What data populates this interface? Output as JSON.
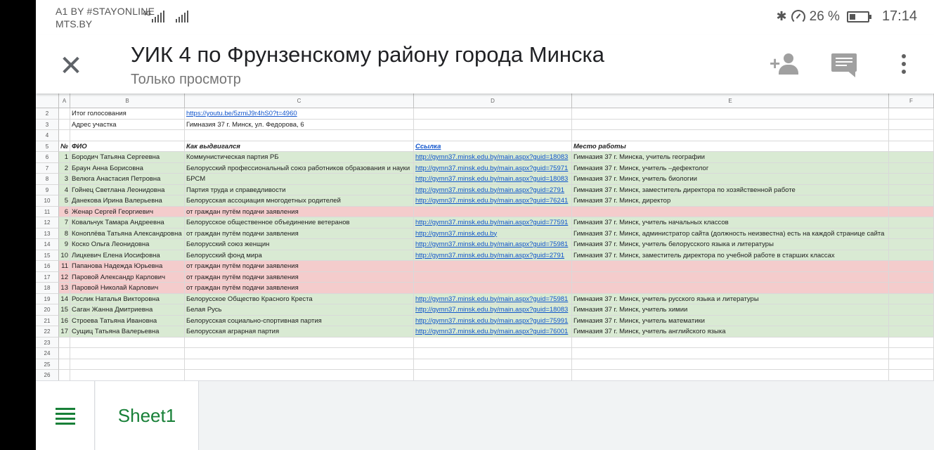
{
  "status_bar": {
    "carrier_line1": "A1 BY #STAYONLINE",
    "carrier_line2": "MTS.BY",
    "network": "4G",
    "bluetooth_icon": "bluetooth-icon",
    "battery_percent": "26 %",
    "time": "17:14"
  },
  "app_bar": {
    "title": "УИК 4 по Фрунзенскому району города Минска",
    "subtitle": "Только просмотр",
    "close_icon": "close-icon",
    "add_person_icon": "add-person-icon",
    "comment_icon": "comment-icon",
    "more_icon": "more-vert-icon"
  },
  "columns": [
    "A",
    "B",
    "C",
    "D",
    "E",
    "F"
  ],
  "rows": [
    {
      "n": "2",
      "a": "",
      "b": "Итог голосования",
      "c": "https://youtu.be/5zmiJ9r4hS0?t=4960",
      "d": "",
      "e": "",
      "c_link": true,
      "style": ""
    },
    {
      "n": "3",
      "a": "",
      "b": "Адрес участка",
      "c": "Гимназия 37 г. Минск, ул. Федорова, 6",
      "d": "",
      "e": "",
      "style": ""
    },
    {
      "n": "4",
      "a": "",
      "b": "",
      "c": "",
      "d": "",
      "e": "",
      "style": ""
    },
    {
      "n": "5",
      "a": "№",
      "b": "ФИО",
      "c": "Как выдвигался",
      "d": "Ссылка",
      "e": "Место работы",
      "style": "header"
    },
    {
      "n": "6",
      "a": "1",
      "b": "Бородич Татьяна Сергеевна",
      "c": "Коммунистическая партия РБ",
      "d": "http://gymn37.minsk.edu.by/main.aspx?guid=18083",
      "e": "Гимназия 37 г. Минска, учитель географии",
      "style": "green"
    },
    {
      "n": "7",
      "a": "2",
      "b": "Браун Анна Борисовна",
      "c": "Белорусский профессиональный союз работников образования и науки",
      "d": "http://gymn37.minsk.edu.by/main.aspx?guid=75971",
      "e": "Гимназия 37 г. Минск, учитель –дефектолог",
      "style": "green"
    },
    {
      "n": "8",
      "a": "3",
      "b": "Велюга Анастасия Петровна",
      "c": "БРСМ",
      "d": "http://gymn37.minsk.edu.by/main.aspx?guid=18083",
      "e": "Гимназия 37 г. Минск, учитель биологии",
      "style": "green"
    },
    {
      "n": "9",
      "a": "4",
      "b": "Гойнец Светлана Леонидовна",
      "c": "Партия труда и справедливости",
      "d": "http://gymn37.minsk.edu.by/main.aspx?guid=2791",
      "e": "Гимназия 37 г. Минск, заместитель директора по хозяйственной работе",
      "style": "green"
    },
    {
      "n": "10",
      "a": "5",
      "b": "Данекова Ирина Валерьевна",
      "c": "Белорусская ассоциация многодетных родителей",
      "d": "http://gymn37.minsk.edu.by/main.aspx?guid=76241",
      "e": "Гимназия 37 г. Минск, директор",
      "style": "green"
    },
    {
      "n": "11",
      "a": "6",
      "b": "Женар Сергей Георгиевич",
      "c": "от граждан путём подачи заявления",
      "d": "",
      "e": "",
      "style": "red"
    },
    {
      "n": "12",
      "a": "7",
      "b": "Ковальчук Тамара Андреевна",
      "c": "Белорусское общественное объединение ветеранов",
      "d": "http://gymn37.minsk.edu.by/main.aspx?guid=77591",
      "e": "Гимназия 37 г. Минск, учитель начальных классов",
      "style": "green"
    },
    {
      "n": "13",
      "a": "8",
      "b": "Коноплёва Татьяна Александровна",
      "c": "от граждан путём подачи заявления",
      "d": "http://gymn37.minsk.edu.by",
      "e": "Гимназия 37 г. Минск, администратор сайта (должность неизвестна) есть на каждой странице сайта",
      "style": "green"
    },
    {
      "n": "14",
      "a": "9",
      "b": "Коско Ольга Леонидовна",
      "c": "Белорусский союз женщин",
      "d": "http://gymn37.minsk.edu.by/main.aspx?guid=75981",
      "e": "Гимназия 37 г. Минск, учитель белорусского языка и литературы",
      "style": "green"
    },
    {
      "n": "15",
      "a": "10",
      "b": "Лицкевич Елена Иосифовна",
      "c": "Белорусский фонд мира",
      "d": "http://gymn37.minsk.edu.by/main.aspx?guid=2791",
      "e": "Гимназия 37 г. Минск, заместитель директора по учебной работе в старших классах",
      "style": "green"
    },
    {
      "n": "16",
      "a": "11",
      "b": "Папанова Надежда Юрьевна",
      "c": "от граждан путём подачи заявления",
      "d": "",
      "e": "",
      "style": "red"
    },
    {
      "n": "17",
      "a": "12",
      "b": "Паровой Александр Карлович",
      "c": "от граждан путём подачи заявления",
      "d": "",
      "e": "",
      "style": "red"
    },
    {
      "n": "18",
      "a": "13",
      "b": "Паровой Николай Карлович",
      "c": "от граждан путём подачи заявления",
      "d": "",
      "e": "",
      "style": "red"
    },
    {
      "n": "19",
      "a": "14",
      "b": "Рослик Наталья Викторовна",
      "c": "Белорусское Общество Красного Креста",
      "d": "http://gymn37.minsk.edu.by/main.aspx?guid=75981",
      "e": "Гимназия 37 г. Минск, учитель русского языка и литературы",
      "style": "green"
    },
    {
      "n": "20",
      "a": "15",
      "b": "Саган Жанна Дмитриевна",
      "c": "Белая Русь",
      "d": "http://gymn37.minsk.edu.by/main.aspx?guid=18083",
      "e": "Гимназия 37 г. Минск, учитель химии",
      "style": "green"
    },
    {
      "n": "21",
      "a": "16",
      "b": "Строева Татьяна Ивановна",
      "c": "Белорусская социально-спортивная партия",
      "d": "http://gymn37.minsk.edu.by/main.aspx?guid=75991",
      "e": "Гимназия 37 г. Минск, учитель математики",
      "style": "green"
    },
    {
      "n": "22",
      "a": "17",
      "b": "Сущиц Татьяна Валерьевна",
      "c": "Белорусская аграрная партия",
      "d": "http://gymn37.minsk.edu.by/main.aspx?guid=76001",
      "e": "Гимназия 37 г. Минск, учитель английского языка",
      "style": "green"
    },
    {
      "n": "23",
      "a": "",
      "b": "",
      "c": "",
      "d": "",
      "e": "",
      "style": ""
    },
    {
      "n": "24",
      "a": "",
      "b": "",
      "c": "",
      "d": "",
      "e": "",
      "style": ""
    },
    {
      "n": "25",
      "a": "",
      "b": "",
      "c": "",
      "d": "",
      "e": "",
      "style": ""
    },
    {
      "n": "26",
      "a": "",
      "b": "",
      "c": "",
      "d": "",
      "e": "",
      "style": ""
    }
  ],
  "bottom_bar": {
    "menu_icon": "hamburger-menu-icon",
    "sheet_tab": "Sheet1"
  },
  "colors": {
    "green_row": "#d9ead3",
    "red_row": "#f4cccc",
    "link": "#1155cc",
    "sheets_green": "#188038"
  }
}
